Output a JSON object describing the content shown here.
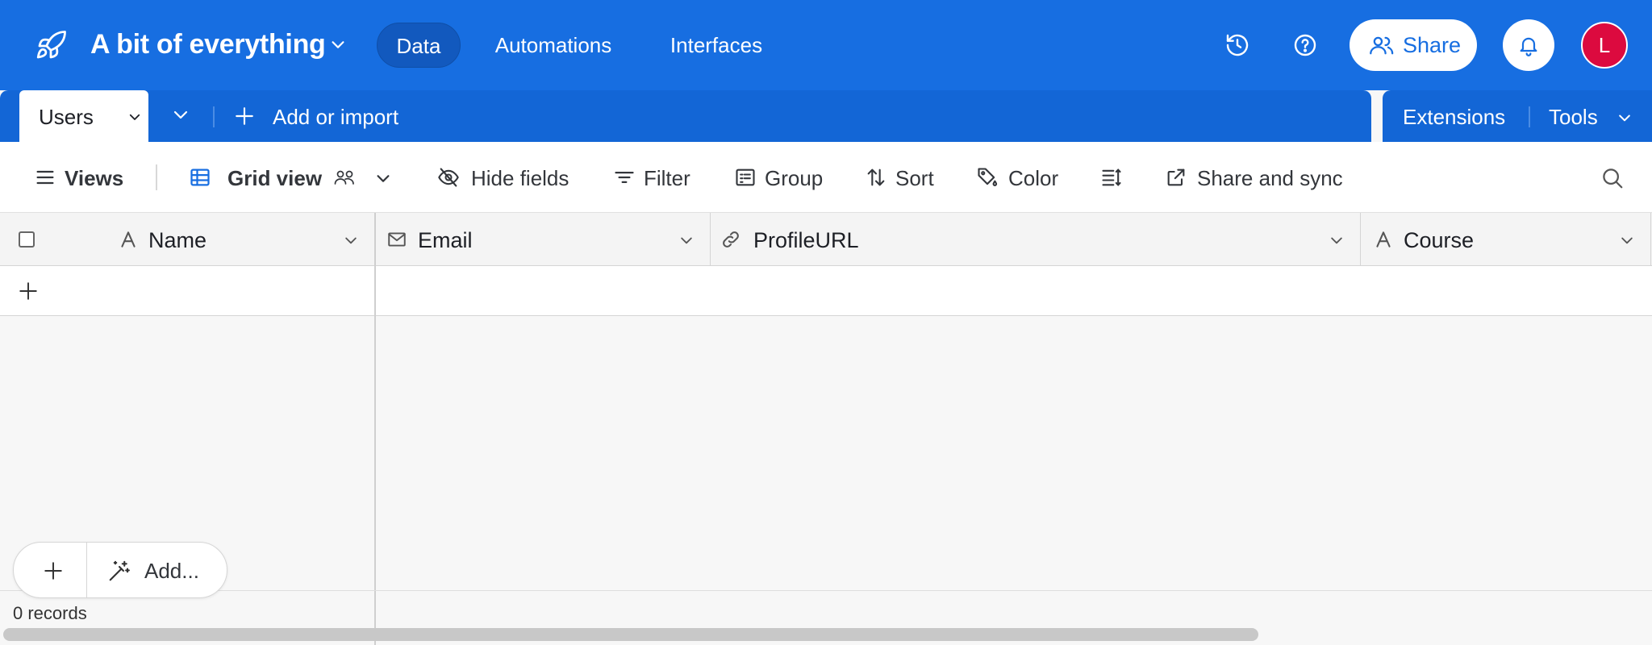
{
  "app": {
    "base_name": "A bit of everything",
    "nav": {
      "data": "Data",
      "automations": "Automations",
      "interfaces": "Interfaces"
    },
    "share_label": "Share",
    "avatar_initial": "L",
    "colors": {
      "brand": "#176ee1",
      "tabbar": "#1366d6",
      "avatar": "#dc0a3f"
    }
  },
  "tables": {
    "active": "Users",
    "add_or_import": "Add or import",
    "extensions": "Extensions",
    "tools": "Tools"
  },
  "viewbar": {
    "views": "Views",
    "grid_view": "Grid view",
    "hide_fields": "Hide fields",
    "filter": "Filter",
    "group": "Group",
    "sort": "Sort",
    "color": "Color",
    "share_sync": "Share and sync"
  },
  "columns": [
    {
      "label": "Name",
      "icon": "text-icon"
    },
    {
      "label": "Email",
      "icon": "mail-icon"
    },
    {
      "label": "ProfileURL",
      "icon": "link-icon"
    },
    {
      "label": "Course",
      "icon": "text-icon"
    }
  ],
  "footer": {
    "add_label": "Add...",
    "record_count": "0 records"
  }
}
